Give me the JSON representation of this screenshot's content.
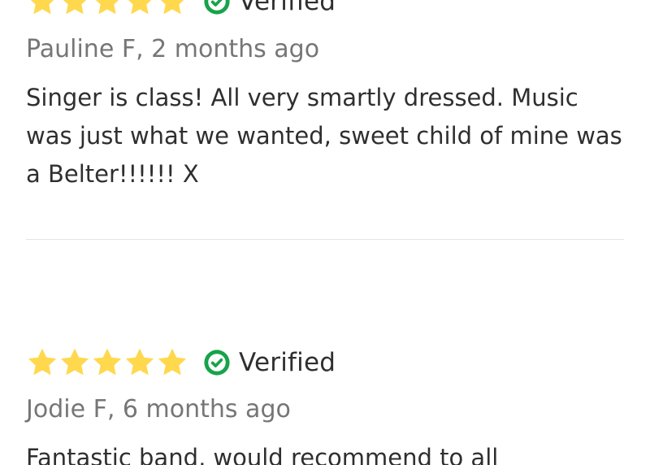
{
  "reviews": [
    {
      "stars": 5,
      "verified_label": "Verified",
      "author_line": "Pauline F, 2 months ago",
      "text": "Singer is class! All very smartly dressed. Music was just what we wanted, sweet child of mine was a Belter!!!!!! X"
    },
    {
      "stars": 5,
      "verified_label": "Verified",
      "author_line": "Jodie F, 6 months ago",
      "text": "Fantastic band, would recommend to all"
    }
  ],
  "colors": {
    "star": "#FFD84E",
    "verified_check": "#17A34A",
    "author_text": "#767676",
    "body_text": "#2F2F2F",
    "divider": "#E4E4E4"
  },
  "icons": {
    "star": "star-icon",
    "verified": "check-circle-icon"
  }
}
